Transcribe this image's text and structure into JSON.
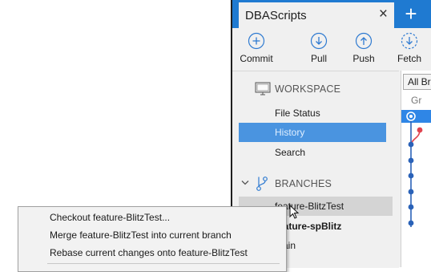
{
  "tab": {
    "title": "DBAScripts",
    "close_icon": "×",
    "add_icon": "+"
  },
  "toolbar": {
    "commit": {
      "label": "Commit",
      "icon": "plus-circle-icon"
    },
    "pull": {
      "label": "Pull",
      "icon": "arrow-down-circle-icon"
    },
    "push": {
      "label": "Push",
      "icon": "arrow-up-circle-icon"
    },
    "fetch": {
      "label": "Fetch",
      "icon": "arrow-down-dashed-circle-icon"
    }
  },
  "sidebar": {
    "workspace_header": "WORKSPACE",
    "workspace_items": [
      {
        "label": "File Status"
      },
      {
        "label": "History",
        "active": true
      },
      {
        "label": "Search"
      }
    ],
    "branches_header": "BRANCHES",
    "branches": [
      {
        "label": "feature-BlitzTest",
        "hovered": true
      },
      {
        "label": "feature-spBlitz",
        "current": true
      },
      {
        "label": "main"
      }
    ]
  },
  "graph": {
    "filter_label": "All Br",
    "column_header": "Gr"
  },
  "context_menu": {
    "items": [
      {
        "label": "Checkout feature-BlitzTest..."
      },
      {
        "label": "Merge feature-BlitzTest into current branch"
      },
      {
        "label": "Rebase current changes onto feature-BlitzTest"
      }
    ]
  },
  "colors": {
    "accent": "#1f7ad1",
    "selection": "#4a94e0",
    "graph_blue": "#2a62b8",
    "graph_red": "#e0434f"
  }
}
